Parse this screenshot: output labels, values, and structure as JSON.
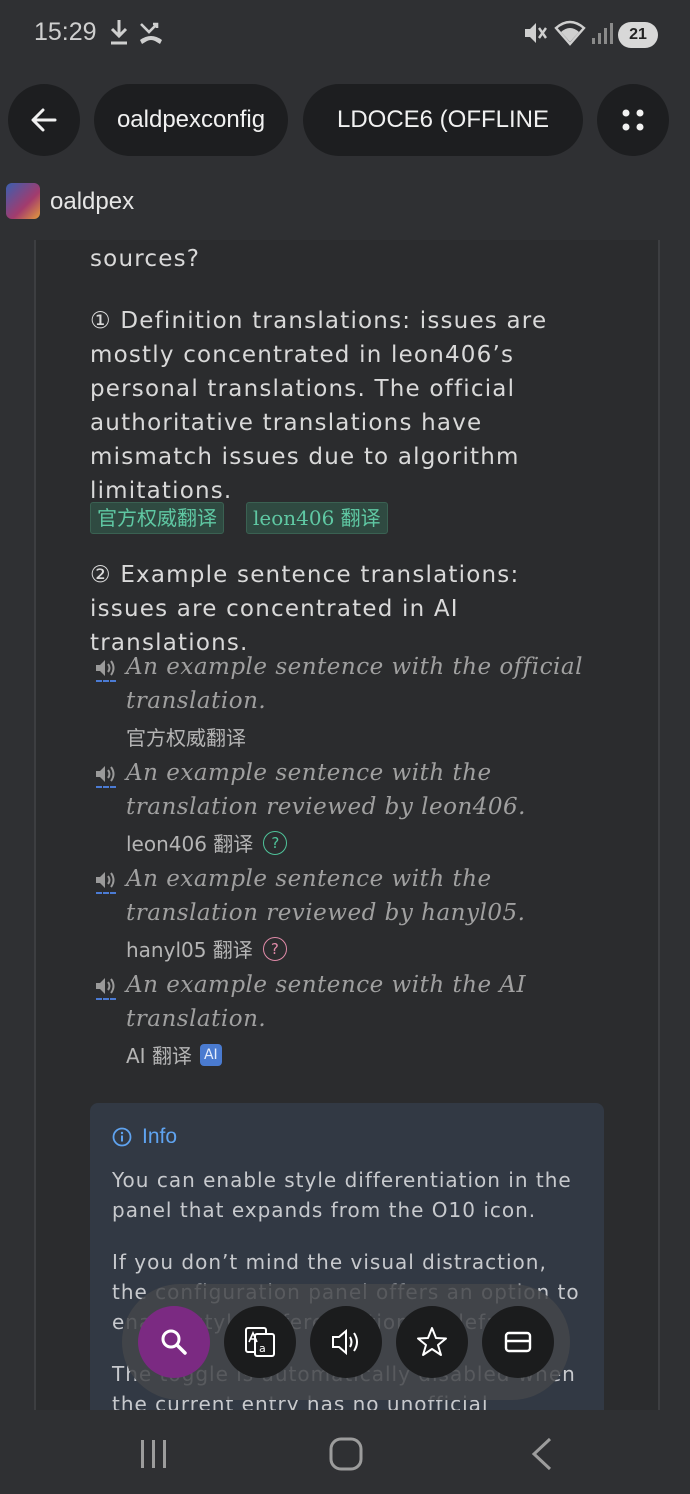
{
  "status_bar": {
    "time": "15:29",
    "battery": "21",
    "icons": [
      "download-icon",
      "missed-call-icon",
      "mute-icon",
      "wifi-icon",
      "signal-icon"
    ]
  },
  "top_bar": {
    "back_icon": "arrow-left-icon",
    "tab_1": "oaldpexconfig",
    "tab_2": "LDOCE6 (OFFLINE",
    "menu_icon": "grid-dots-icon"
  },
  "app": {
    "name": "oaldpex"
  },
  "content": {
    "heading_tail": "sources?",
    "definition_note": "① Definition translations: issues are mostly concentrated in leon406’s personal translations. The official authoritative translations have mismatch issues due to algorithm limitations.",
    "tag_official": "官方权威翻译",
    "tag_leon": "leon406 翻译",
    "example_note": "② Example sentence translations: issues are concentrated in AI translations.",
    "examples": [
      {
        "sentence": "An example sentence with the official translation.",
        "translation": "官方权威翻译",
        "badge": ""
      },
      {
        "sentence": "An example sentence with the translation reviewed by leon406.",
        "translation": "leon406 翻译",
        "badge": "?"
      },
      {
        "sentence": "An example sentence with the translation reviewed by hanyl05.",
        "translation": "hanyl05 翻译",
        "badge": "?"
      },
      {
        "sentence": "An example sentence with the AI translation.",
        "translation": "AI 翻译",
        "badge": "AI"
      }
    ]
  },
  "info": {
    "title": "Info",
    "p1": "You can enable style differentiation in the panel that expands from the O10 icon.",
    "p2": "If you don’t mind the visual distraction, the configuration panel offers an option to enable style differentiation by default.",
    "p3": "The toggle is automatically disabled when the current entry has no unofficial"
  },
  "toolbar": {
    "buttons": [
      "search-icon",
      "translate-icon",
      "speaker-icon",
      "star-icon",
      "panel-icon"
    ]
  },
  "colors": {
    "accent_search": "#7b2a82",
    "tag_green": "#5fc8a3",
    "question_green": "#4fc39a",
    "question_pink": "#e08aa8",
    "ai_blue": "#4a7bd0",
    "info_blue": "#5fa3f0"
  }
}
